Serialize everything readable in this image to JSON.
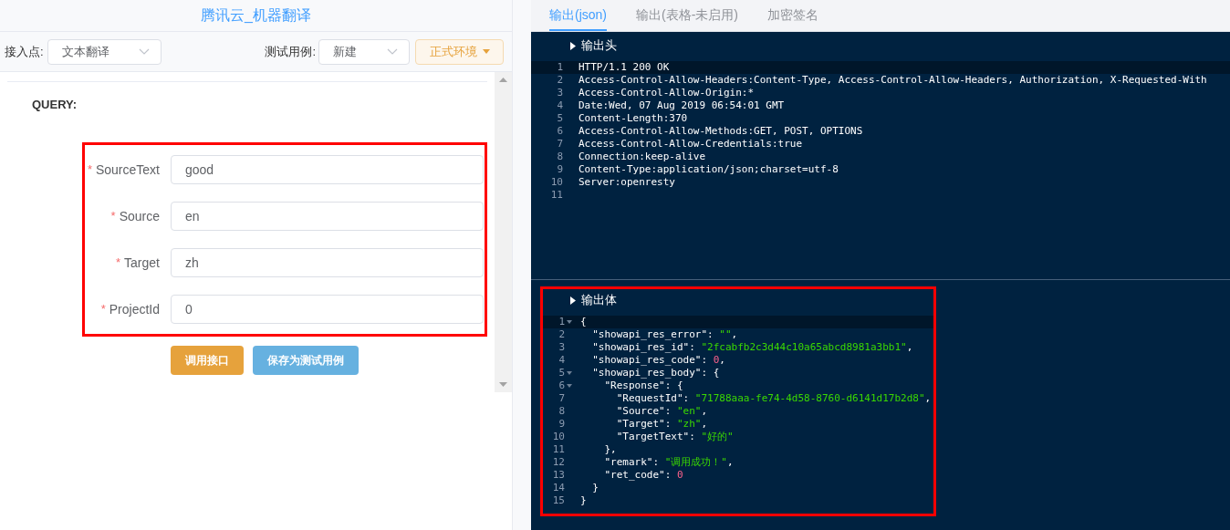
{
  "left_panel": {
    "title": "腾讯云_机器翻译",
    "endpoint": {
      "label": "接入点:",
      "value": "文本翻译"
    },
    "test_case": {
      "label": "测试用例:",
      "value": "新建"
    },
    "environment_button": "正式环境",
    "section_title": "QUERY:",
    "form": {
      "highlighted": true,
      "fields": [
        {
          "label": "SourceText",
          "required_mark": "*",
          "value": "good"
        },
        {
          "label": "Source",
          "required_mark": "*",
          "value": "en"
        },
        {
          "label": "Target",
          "required_mark": "*",
          "value": "zh"
        },
        {
          "label": "ProjectId",
          "required_mark": "*",
          "value": "0"
        }
      ]
    },
    "buttons": [
      {
        "label": "调用接口",
        "kind": "primary"
      },
      {
        "label": "保存为测试用例",
        "kind": "secondary"
      }
    ]
  },
  "right_panel": {
    "tabs": [
      {
        "label": "输出(json)",
        "selected": true
      },
      {
        "label": "输出(表格-未启用)",
        "selected": false
      },
      {
        "label": "加密签名",
        "selected": false
      }
    ],
    "output_header": {
      "title": "输出头",
      "lines": [
        {
          "num": "1",
          "tokens": [
            {
              "kind": "plain",
              "text": "HTTP/1.1 200 OK"
            }
          ]
        },
        {
          "num": "2",
          "tokens": [
            {
              "kind": "plain",
              "text": "Access-Control-Allow-Headers:Content-Type, Access-Control-Allow-Headers, Authorization, X-Requested-With"
            }
          ]
        },
        {
          "num": "3",
          "tokens": [
            {
              "kind": "plain",
              "text": "Access-Control-Allow-Origin:*"
            }
          ]
        },
        {
          "num": "4",
          "tokens": [
            {
              "kind": "plain",
              "text": "Date:Wed, 07 Aug 2019 06:54:01 GMT"
            }
          ]
        },
        {
          "num": "5",
          "tokens": [
            {
              "kind": "plain",
              "text": "Content-Length:370"
            }
          ]
        },
        {
          "num": "6",
          "tokens": [
            {
              "kind": "plain",
              "text": "Access-Control-Allow-Methods:GET, POST, OPTIONS"
            }
          ]
        },
        {
          "num": "7",
          "tokens": [
            {
              "kind": "plain",
              "text": "Access-Control-Allow-Credentials:true"
            }
          ]
        },
        {
          "num": "8",
          "tokens": [
            {
              "kind": "plain",
              "text": "Connection:keep-alive"
            }
          ]
        },
        {
          "num": "9",
          "tokens": [
            {
              "kind": "plain",
              "text": "Content-Type:application/json;charset=utf-8"
            }
          ]
        },
        {
          "num": "10",
          "tokens": [
            {
              "kind": "plain",
              "text": "Server:openresty"
            }
          ]
        },
        {
          "num": "11"
        }
      ]
    },
    "output_body": {
      "title": "输出体",
      "highlighted": true,
      "lines": [
        {
          "num": "1",
          "fold": true,
          "tokens": [
            {
              "kind": "plain",
              "text": "{"
            }
          ]
        },
        {
          "num": "2",
          "tokens": [
            {
              "kind": "plain",
              "text": "  \"showapi_res_error\": "
            },
            {
              "kind": "string",
              "text": "\"\""
            },
            {
              "kind": "plain",
              "text": ","
            }
          ]
        },
        {
          "num": "3",
          "tokens": [
            {
              "kind": "plain",
              "text": "  \"showapi_res_id\": "
            },
            {
              "kind": "string",
              "text": "\"2fcabfb2c3d44c10a65abcd8981a3bb1\""
            },
            {
              "kind": "plain",
              "text": ","
            }
          ]
        },
        {
          "num": "4",
          "tokens": [
            {
              "kind": "plain",
              "text": "  \"showapi_res_code\": "
            },
            {
              "kind": "number",
              "text": "0"
            },
            {
              "kind": "plain",
              "text": ","
            }
          ]
        },
        {
          "num": "5",
          "fold": true,
          "tokens": [
            {
              "kind": "plain",
              "text": "  \"showapi_res_body\": {"
            }
          ]
        },
        {
          "num": "6",
          "fold": true,
          "tokens": [
            {
              "kind": "plain",
              "text": "    \"Response\": {"
            }
          ]
        },
        {
          "num": "7",
          "tokens": [
            {
              "kind": "plain",
              "text": "      \"RequestId\": "
            },
            {
              "kind": "string",
              "text": "\"71788aaa-fe74-4d58-8760-d6141d17b2d8\""
            },
            {
              "kind": "plain",
              "text": ","
            }
          ]
        },
        {
          "num": "8",
          "tokens": [
            {
              "kind": "plain",
              "text": "      \"Source\": "
            },
            {
              "kind": "string",
              "text": "\"en\""
            },
            {
              "kind": "plain",
              "text": ","
            }
          ]
        },
        {
          "num": "9",
          "tokens": [
            {
              "kind": "plain",
              "text": "      \"Target\": "
            },
            {
              "kind": "string",
              "text": "\"zh\""
            },
            {
              "kind": "plain",
              "text": ","
            }
          ]
        },
        {
          "num": "10",
          "tokens": [
            {
              "kind": "plain",
              "text": "      \"TargetText\": "
            },
            {
              "kind": "string",
              "text": "\"好的\""
            }
          ]
        },
        {
          "num": "11",
          "tokens": [
            {
              "kind": "plain",
              "text": "    },"
            }
          ]
        },
        {
          "num": "12",
          "tokens": [
            {
              "kind": "plain",
              "text": "    \"remark\": "
            },
            {
              "kind": "string",
              "text": "\"调用成功！\""
            },
            {
              "kind": "plain",
              "text": ","
            }
          ]
        },
        {
          "num": "13",
          "tokens": [
            {
              "kind": "plain",
              "text": "    \"ret_code\": "
            },
            {
              "kind": "number",
              "text": "0"
            }
          ]
        },
        {
          "num": "14",
          "tokens": [
            {
              "kind": "plain",
              "text": "  }"
            }
          ]
        },
        {
          "num": "15",
          "tokens": [
            {
              "kind": "plain",
              "text": "}"
            }
          ]
        }
      ]
    }
  }
}
